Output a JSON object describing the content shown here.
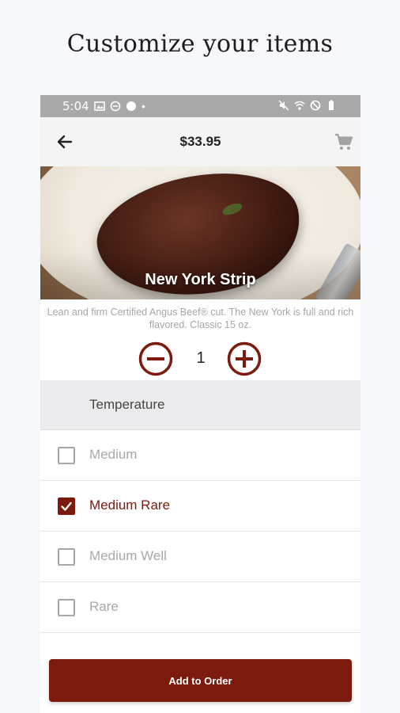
{
  "headline": "Customize your items",
  "status_bar": {
    "time": "5:04",
    "dot": "•"
  },
  "app_bar": {
    "price": "$33.95"
  },
  "item": {
    "name": "New York Strip",
    "description": "Lean and firm Certified Angus Beef® cut. The New York is full and rich flavored. Classic 15 oz."
  },
  "quantity": {
    "value": "1"
  },
  "section": {
    "title": "Temperature"
  },
  "options": [
    {
      "label": "Medium",
      "checked": false
    },
    {
      "label": "Medium Rare",
      "checked": true
    },
    {
      "label": "Medium Well",
      "checked": false
    },
    {
      "label": "Rare",
      "checked": false
    }
  ],
  "cta": {
    "label": "Add to Order"
  },
  "colors": {
    "accent": "#7b1a0d",
    "muted_text": "#a8a8a8",
    "status_bar": "#a9a9a9"
  },
  "icons": [
    "back-arrow-icon",
    "cart-icon",
    "minus-circle-icon",
    "plus-circle-icon",
    "checkbox-icon",
    "checkmark-icon"
  ]
}
